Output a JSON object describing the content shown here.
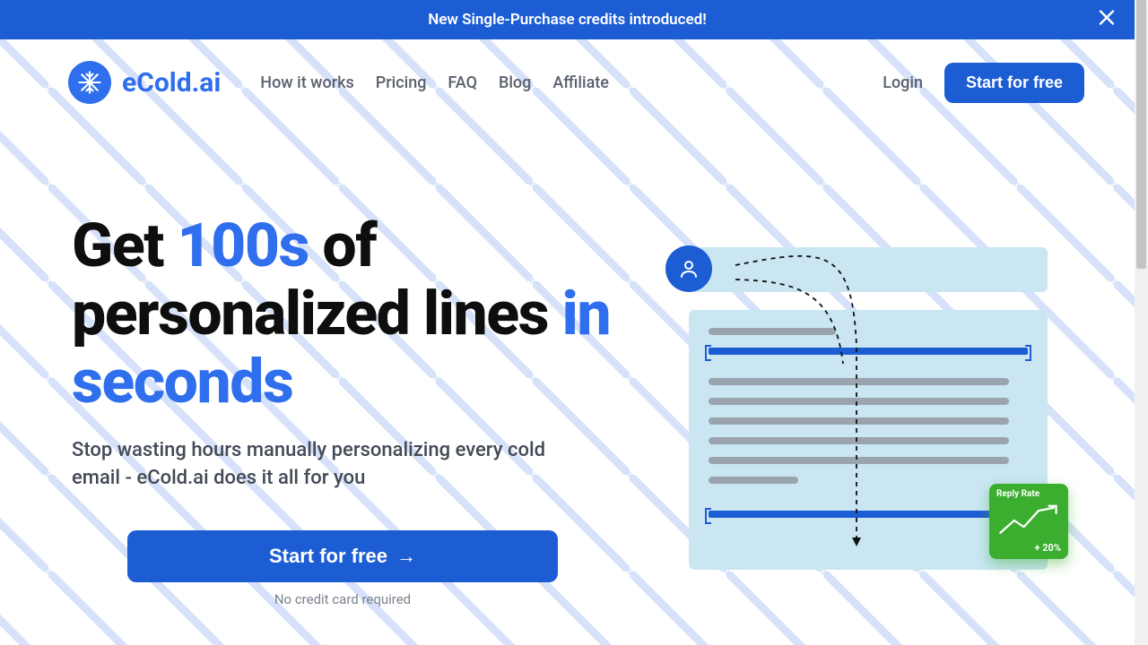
{
  "banner": {
    "text": "New Single-Purchase credits introduced!",
    "close_icon": "close"
  },
  "brand": {
    "name": "eCold.ai",
    "icon": "snowflake"
  },
  "nav": {
    "items": [
      {
        "label": "How it works"
      },
      {
        "label": "Pricing"
      },
      {
        "label": "FAQ"
      },
      {
        "label": "Blog"
      },
      {
        "label": "Affiliate"
      }
    ],
    "login": "Login",
    "cta": "Start for free"
  },
  "hero": {
    "title_pre": "Get ",
    "title_accent1": "100s",
    "title_mid": " of personalized lines ",
    "title_accent2": "in seconds",
    "subtitle": "Stop wasting hours manually personalizing every cold email - eCold.ai does it all for you",
    "cta": "Start for free",
    "cta_arrow": "→",
    "note": "No credit card required"
  },
  "illustration": {
    "reply_label": "Reply Rate",
    "reply_delta": "+ 20%"
  }
}
